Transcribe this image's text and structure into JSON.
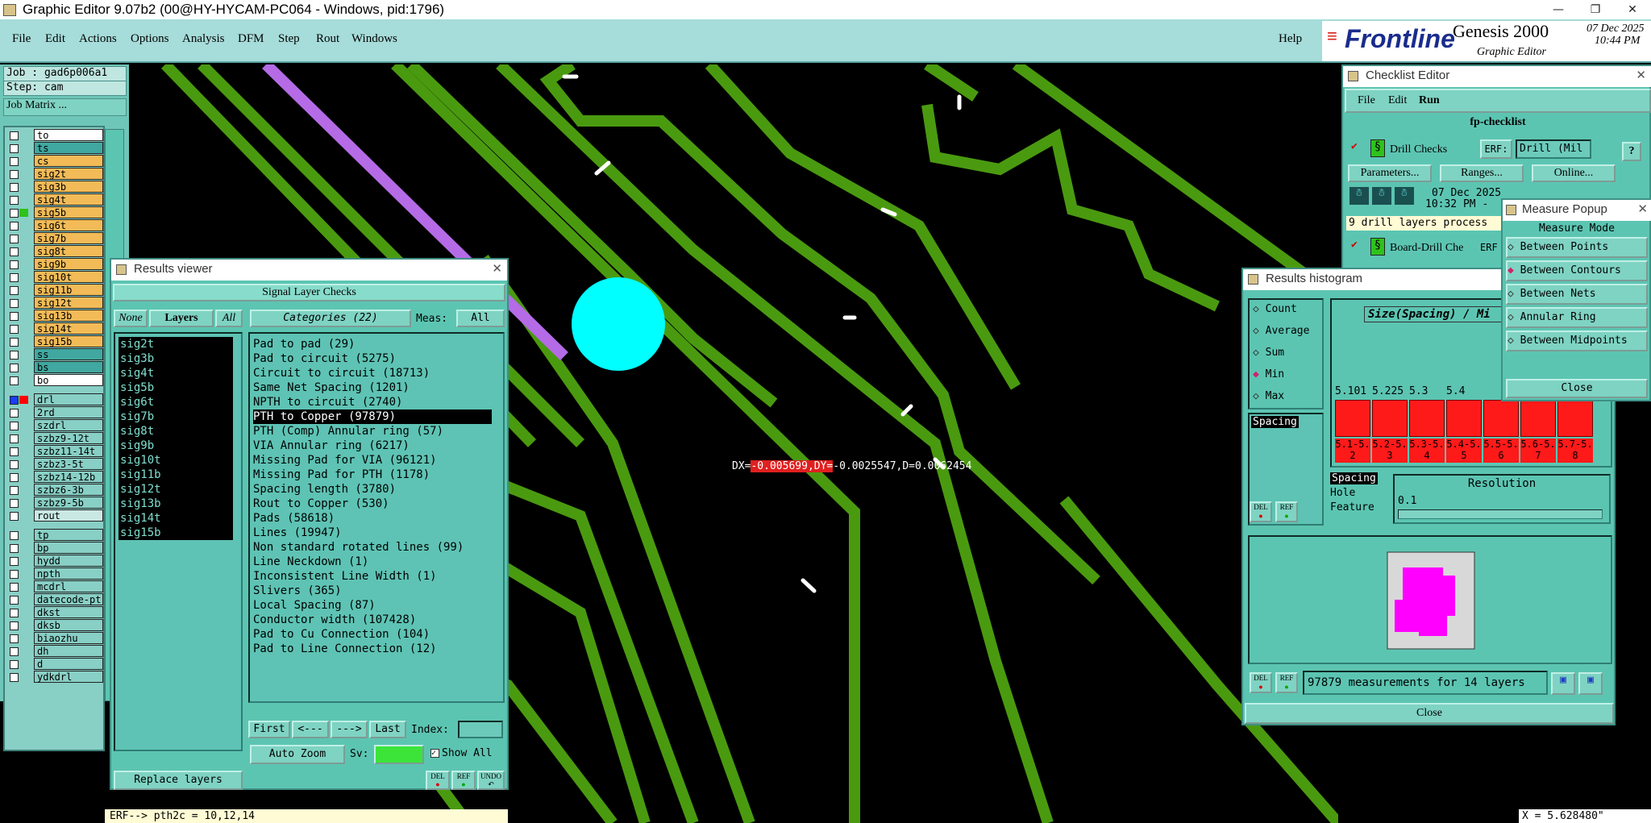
{
  "window": {
    "title": "Graphic Editor 9.07b2 (00@HY-HYCAM-PC064 - Windows, pid:1796)"
  },
  "menu": [
    "File",
    "Edit",
    "Actions",
    "Options",
    "Analysis",
    "DFM",
    "Step",
    "Rout",
    "Windows"
  ],
  "help": "Help",
  "brand": {
    "logo": "Frontline",
    "product": "Genesis 2000",
    "module": "Graphic Editor",
    "date": "07 Dec 2025",
    "time": "10:44 PM"
  },
  "job": {
    "job_label": "Job : gad6p006a1",
    "step_label": "Step: cam",
    "matrix_button": "Job Matrix ..."
  },
  "layers": [
    {
      "name": "to",
      "color": "#ffffff"
    },
    {
      "name": "ts",
      "color": "#40a8a0"
    },
    {
      "name": "cs",
      "color": "#f2bb57"
    },
    {
      "name": "sig2t",
      "color": "#f2bb57"
    },
    {
      "name": "sig3b",
      "color": "#f2bb57"
    },
    {
      "name": "sig4t",
      "color": "#f2bb57"
    },
    {
      "name": "sig5b",
      "color": "#f2bb57"
    },
    {
      "name": "sig6t",
      "color": "#f2bb57"
    },
    {
      "name": "sig7b",
      "color": "#f2bb57"
    },
    {
      "name": "sig8t",
      "color": "#f2bb57"
    },
    {
      "name": "sig9b",
      "color": "#f2bb57"
    },
    {
      "name": "sig10t",
      "color": "#f2bb57"
    },
    {
      "name": "sig11b",
      "color": "#f2bb57"
    },
    {
      "name": "sig12t",
      "color": "#f2bb57"
    },
    {
      "name": "sig13b",
      "color": "#f2bb57"
    },
    {
      "name": "sig14t",
      "color": "#f2bb57"
    },
    {
      "name": "sig15b",
      "color": "#f2bb57"
    },
    {
      "name": "ss",
      "color": "#40a8a0"
    },
    {
      "name": "bs",
      "color": "#40a8a0"
    },
    {
      "name": "bo",
      "color": "#ffffff"
    },
    {
      "name": "drl",
      "color": "#88cfc5"
    },
    {
      "name": "2rd",
      "color": "#88cfc5"
    },
    {
      "name": "szdrl",
      "color": "#88cfc5"
    },
    {
      "name": "szbz9-12t",
      "color": "#88cfc5"
    },
    {
      "name": "szbz11-14t",
      "color": "#88cfc5"
    },
    {
      "name": "szbz3-5t",
      "color": "#88cfc5"
    },
    {
      "name": "szbz14-12b",
      "color": "#88cfc5"
    },
    {
      "name": "szbz6-3b",
      "color": "#88cfc5"
    },
    {
      "name": "szbz9-5b",
      "color": "#88cfc5"
    },
    {
      "name": "rout",
      "color": "#c9e8e4"
    },
    {
      "name": "tp",
      "color": "#88cfc5"
    },
    {
      "name": "bp",
      "color": "#88cfc5"
    },
    {
      "name": "hydd",
      "color": "#88cfc5"
    },
    {
      "name": "npth",
      "color": "#88cfc5"
    },
    {
      "name": "mcdrl",
      "color": "#88cfc5"
    },
    {
      "name": "datecode-pt",
      "color": "#88cfc5"
    },
    {
      "name": "dkst",
      "color": "#88cfc5"
    },
    {
      "name": "dksb",
      "color": "#88cfc5"
    },
    {
      "name": "biaozhu",
      "color": "#88cfc5"
    },
    {
      "name": "dh",
      "color": "#88cfc5"
    },
    {
      "name": "d",
      "color": "#88cfc5"
    },
    {
      "name": "ydkdrl",
      "color": "#88cfc5"
    }
  ],
  "results_viewer": {
    "title": "Results viewer",
    "header": "Signal Layer Checks",
    "none": "None",
    "layers": "Layers",
    "all": "All",
    "categories_label": "Categories (22)",
    "meas_label": "Meas:",
    "meas_value": "All",
    "layer_items": [
      "sig2t",
      "sig3b",
      "sig4t",
      "sig5b",
      "sig6t",
      "sig7b",
      "sig8t",
      "sig9b",
      "sig10t",
      "sig11b",
      "sig12t",
      "sig13b",
      "sig14t",
      "sig15b"
    ],
    "categories": [
      "Pad to pad (29)",
      "Pad to circuit (5275)",
      "Circuit to circuit (18713)",
      "Same Net Spacing (1201)",
      "NPTH to circuit (2740)",
      "PTH to Copper (97879)",
      "PTH (Comp) Annular ring (57)",
      "VIA Annular ring (6217)",
      "Missing Pad for VIA (96121)",
      "Missing Pad for PTH (1178)",
      "Spacing length (3780)",
      "Rout to Copper (530)",
      "Pads (58618)",
      "Lines (19947)",
      "Non standard rotated lines (99)",
      "Line Neckdown (1)",
      "Inconsistent Line Width (1)",
      "Slivers (365)",
      "Local Spacing (87)",
      "Conductor width (107428)",
      "Pad to Cu Connection (104)",
      "Pad to Line Connection (12)"
    ],
    "selected_category": "PTH to Copper (97879)",
    "first": "First",
    "prev": "<---",
    "next": "--->",
    "last": "Last",
    "index_label": "Index:",
    "auto_zoom": "Auto Zoom",
    "sv_label": "Sv:",
    "show_all": "Show All",
    "replace_layers": "Replace layers",
    "del": "DEL",
    "ref": "REF",
    "undo": "UNDO"
  },
  "measure_label": {
    "prefix": "DX=",
    "dx": "-0.005699",
    "dy_prefix": ",DY=",
    "rest": "-0.0025547,D=0.0062454"
  },
  "checklist": {
    "title": "Checklist Editor",
    "menu": [
      "File",
      "Edit",
      "Run"
    ],
    "name": "fp-checklist",
    "row1": "Drill Checks",
    "erf_label": "ERF:",
    "erf_value": "Drill (Mil",
    "help": "?",
    "parameters": "Parameters...",
    "ranges": "Ranges...",
    "online": "Online...",
    "date": "07 Dec 2025",
    "time": "10:32 PM -",
    "status": "9 drill layers process",
    "row2": "Board-Drill Che",
    "row2_erf": "ERF"
  },
  "measure_popup": {
    "title": "Measure Popup",
    "mode_label": "Measure Mode",
    "modes": [
      "Between Points",
      "Between Contours",
      "Between Nets",
      "Annular Ring",
      "Between Midpoints"
    ],
    "selected": "Between Contours",
    "close": "Close"
  },
  "histogram": {
    "title": "Results histogram",
    "options": [
      "Count",
      "Average",
      "Sum",
      "Min",
      "Max"
    ],
    "selected_option": "Min",
    "list_item": "Spacing",
    "chart_title": "Size(Spacing) / Mi",
    "top_values": [
      "5.101",
      "5.225",
      "5.3",
      "5.4"
    ],
    "bin_labels": [
      "5.1-5.2",
      "5.2-5.3",
      "5.3-5.4",
      "5.4-5.5",
      "5.5-5.6",
      "5.6-5.7",
      "5.7-5.8"
    ],
    "type_items": [
      "Spacing",
      "Hole",
      "Feature"
    ],
    "resolution_label": "Resolution",
    "resolution_value": "0.1",
    "measurements": "97879 measurements for 14 layers",
    "close": "Close",
    "del": "DEL",
    "ref": "REF"
  },
  "coordinate": "X = 5.628480\"",
  "status_bar": "ERF--> pth2c = 10,12,14",
  "colors": {
    "trace": "#4a9a10",
    "board_bg": "#000000",
    "drill_cyan": "#00ffff",
    "pad_red": "#ff0000",
    "highlight": "#b56be6"
  }
}
